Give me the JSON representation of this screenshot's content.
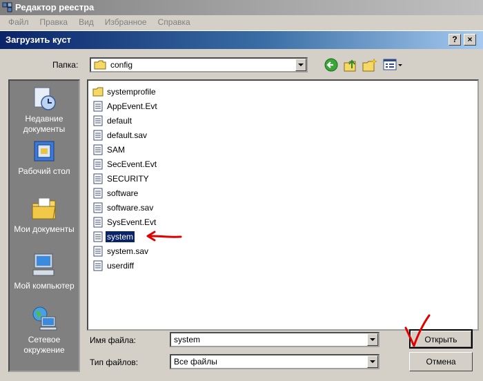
{
  "app": {
    "title": "Редактор реестра",
    "menu": [
      "Файл",
      "Правка",
      "Вид",
      "Избранное",
      "Справка"
    ]
  },
  "dialog": {
    "title": "Загрузить куст",
    "help_btn": "?",
    "close_btn": "×"
  },
  "folder": {
    "label": "Папка:",
    "value": "config"
  },
  "places": [
    {
      "label": "Недавние документы",
      "icon": "recent-documents-icon"
    },
    {
      "label": "Рабочий стол",
      "icon": "desktop-icon"
    },
    {
      "label": "Мои документы",
      "icon": "my-documents-icon"
    },
    {
      "label": "Мой компьютер",
      "icon": "my-computer-icon"
    },
    {
      "label": "Сетевое окружение",
      "icon": "network-icon"
    }
  ],
  "files": [
    {
      "name": "systemprofile",
      "type": "folder"
    },
    {
      "name": "AppEvent.Evt",
      "type": "file"
    },
    {
      "name": "default",
      "type": "file"
    },
    {
      "name": "default.sav",
      "type": "file"
    },
    {
      "name": "SAM",
      "type": "file"
    },
    {
      "name": "SecEvent.Evt",
      "type": "file"
    },
    {
      "name": "SECURITY",
      "type": "file"
    },
    {
      "name": "software",
      "type": "file"
    },
    {
      "name": "software.sav",
      "type": "file"
    },
    {
      "name": "SysEvent.Evt",
      "type": "file"
    },
    {
      "name": "system",
      "type": "file",
      "selected": true
    },
    {
      "name": "system.sav",
      "type": "file"
    },
    {
      "name": "userdiff",
      "type": "file"
    }
  ],
  "filename": {
    "label": "Имя файла:",
    "value": "system"
  },
  "filetype": {
    "label": "Тип файлов:",
    "value": "Все файлы"
  },
  "buttons": {
    "open": "Открыть",
    "cancel": "Отмена"
  },
  "colors": {
    "annotation": "#e00000",
    "title_bar": "#0a246a",
    "selection": "#0a246a"
  }
}
